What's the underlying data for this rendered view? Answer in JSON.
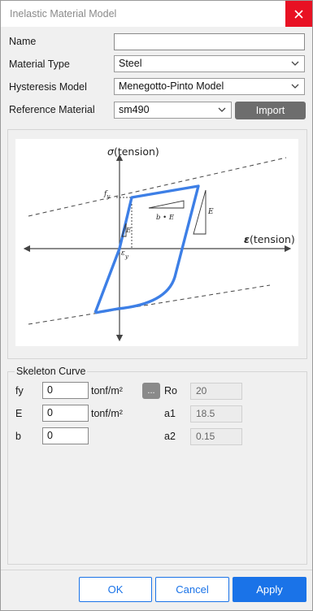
{
  "window": {
    "title": "Inelastic Material Model"
  },
  "fields": {
    "name": {
      "label": "Name",
      "value": ""
    },
    "material_type": {
      "label": "Material Type",
      "value": "Steel"
    },
    "hysteresis_model": {
      "label": "Hysteresis Model",
      "value": "Menegotto-Pinto Model"
    },
    "reference_material": {
      "label": "Reference Material",
      "value": "sm490"
    },
    "import_label": "Import"
  },
  "diagram": {
    "y_symbol": "σ",
    "y_label": "(tension)",
    "x_symbol": "ε",
    "x_label": "(tension)",
    "fy_main": "f",
    "fy_sub": "y",
    "ey_main": "ε",
    "ey_sub": "y",
    "bE_label": "b • E",
    "E_label_large": "E",
    "E_label_small": "E"
  },
  "skeleton": {
    "title": "Skeleton Curve",
    "fy": {
      "label": "fy",
      "value": "0",
      "unit": "tonf/m²"
    },
    "E": {
      "label": "E",
      "value": "0",
      "unit": "tonf/m²"
    },
    "b": {
      "label": "b",
      "value": "0"
    },
    "more_label": "...",
    "Ro": {
      "label": "Ro",
      "value": "20"
    },
    "a1": {
      "label": "a1",
      "value": "18.5"
    },
    "a2": {
      "label": "a2",
      "value": "0.15"
    }
  },
  "buttons": {
    "ok": "OK",
    "cancel": "Cancel",
    "apply": "Apply"
  },
  "colors": {
    "accent": "#1a73e8",
    "close": "#e81123",
    "curve": "#3d7fe6"
  }
}
